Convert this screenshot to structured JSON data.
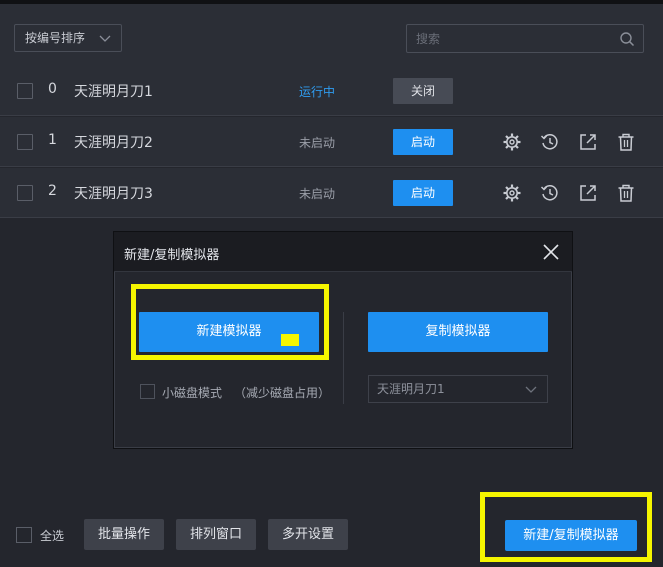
{
  "header": {
    "sort_label": "按编号排序",
    "search_placeholder": "搜索"
  },
  "rows": [
    {
      "index": "0",
      "name": "天涯明月刀1",
      "status": "运行中",
      "action": "关闭"
    },
    {
      "index": "1",
      "name": "天涯明月刀2",
      "status": "未启动",
      "action": "启动"
    },
    {
      "index": "2",
      "name": "天涯明月刀3",
      "status": "未启动",
      "action": "启动"
    }
  ],
  "row_icons": [
    "gear-icon",
    "history-icon",
    "export-icon",
    "trash-icon"
  ],
  "modal": {
    "title": "新建/复制模拟器",
    "new_label": "新建模拟器",
    "copy_label": "复制模拟器",
    "small_disk_label": "小磁盘模式",
    "small_disk_note": "（减少磁盘占用）",
    "copy_source": "天涯明月刀1"
  },
  "footer": {
    "select_all": "全选",
    "batch": "批量操作",
    "arrange": "排列窗口",
    "multi": "多开设置",
    "new_copy": "新建/复制模拟器"
  },
  "colors": {
    "accent": "#1e8ff0",
    "running": "#2f9cf0",
    "highlight": "#f5f500",
    "background": "#24262d"
  }
}
